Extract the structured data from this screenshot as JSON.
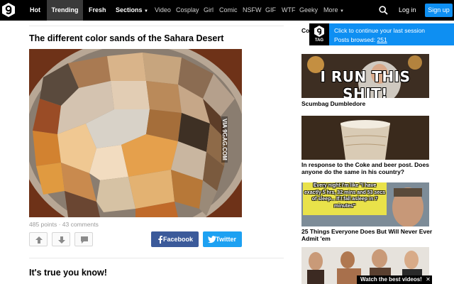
{
  "nav": {
    "hot": "Hot",
    "trending": "Trending",
    "fresh": "Fresh",
    "sections": "Sections",
    "links": [
      "Video",
      "Cosplay",
      "Girl",
      "Comic",
      "NSFW",
      "GIF",
      "WTF",
      "Geeky",
      "More"
    ],
    "login": "Log in",
    "signup": "Sign up"
  },
  "post": {
    "title": "The different color sands of the Sahara Desert",
    "watermark": "VIA 9GAG.COM",
    "points": "485 points",
    "separator": " · ",
    "comments": "43 comments",
    "facebook": "Facebook",
    "twitter": "Twitter"
  },
  "post2": {
    "title": "It's true you know!"
  },
  "sidebar": {
    "items": [
      {
        "image_text": "I RUN THIS SHIT!",
        "caption": "Scumbag Dumbledore"
      },
      {
        "image_text": "",
        "caption": "In response to the Coke and beer post. Does anyone do the same in his country?"
      },
      {
        "image_text": "Every night I'm like \"I have exactly 5 hrs, 32 mins and 53 secs of sleep... If I fall asleep in 7 minutes\"",
        "caption": "25 Things Everyone Does But Will Never Ever Admit 'em"
      }
    ],
    "partial_caption": "Co"
  },
  "popup": {
    "tag": "TAG",
    "line1": "Click to continue your last session",
    "line2_label": "Posts browsed: ",
    "line2_count": "251"
  },
  "bottom": {
    "watch": "Watch the best videos!",
    "close": "✕"
  },
  "colors": {
    "accent": "#0e8ff2",
    "facebook": "#3b5a9a",
    "twitter": "#1da1f2",
    "nav_bg": "#000000"
  }
}
